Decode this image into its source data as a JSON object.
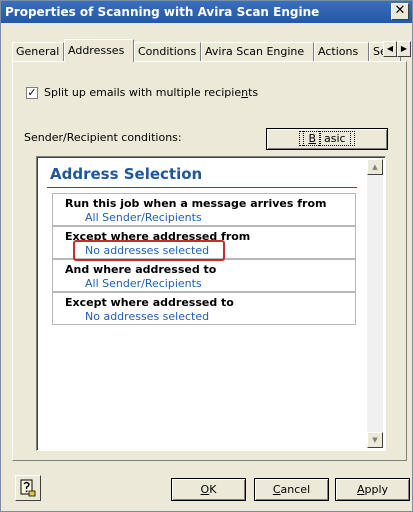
{
  "window": {
    "title": "Properties of Scanning with Avira Scan Engine",
    "close_glyph": "✕"
  },
  "tabs": [
    {
      "label": "General"
    },
    {
      "label": "Addresses"
    },
    {
      "label": "Conditions"
    },
    {
      "label": "Avira Scan Engine"
    },
    {
      "label": "Actions"
    },
    {
      "label": "Servi"
    }
  ],
  "active_tab": "Addresses",
  "tab_scroll": {
    "left": "◀",
    "right": "▶"
  },
  "split_checkbox": {
    "checked": true,
    "label_pre": "Split up emails with multiple recipie",
    "label_u": "n",
    "label_post": "ts"
  },
  "conditions_label": "Sender/Recipient conditions:",
  "basic_button": {
    "pre": "",
    "u": "B",
    "post": "asic"
  },
  "address_selection": {
    "title": "Address Selection",
    "conditions": [
      {
        "title": "Run this job when a message arrives from",
        "value": "All Sender/Recipients"
      },
      {
        "title": "Except where addressed from",
        "value": "No addresses selected",
        "highlighted": true
      },
      {
        "title": "And where addressed to",
        "value": "All Sender/Recipients"
      },
      {
        "title": "Except where addressed to",
        "value": "No addresses selected"
      }
    ]
  },
  "scrollbar": {
    "up": "▲",
    "down": "▼"
  },
  "buttons": {
    "ok": {
      "u": "O",
      "post": "K"
    },
    "cancel": {
      "u": "C",
      "post": "ancel"
    },
    "apply": {
      "u": "A",
      "post": "pply"
    }
  },
  "colors": {
    "accent": "#1f5797",
    "link": "#1f5fb5",
    "highlight": "#cc2a2a",
    "titlebar": "#2457a8"
  }
}
